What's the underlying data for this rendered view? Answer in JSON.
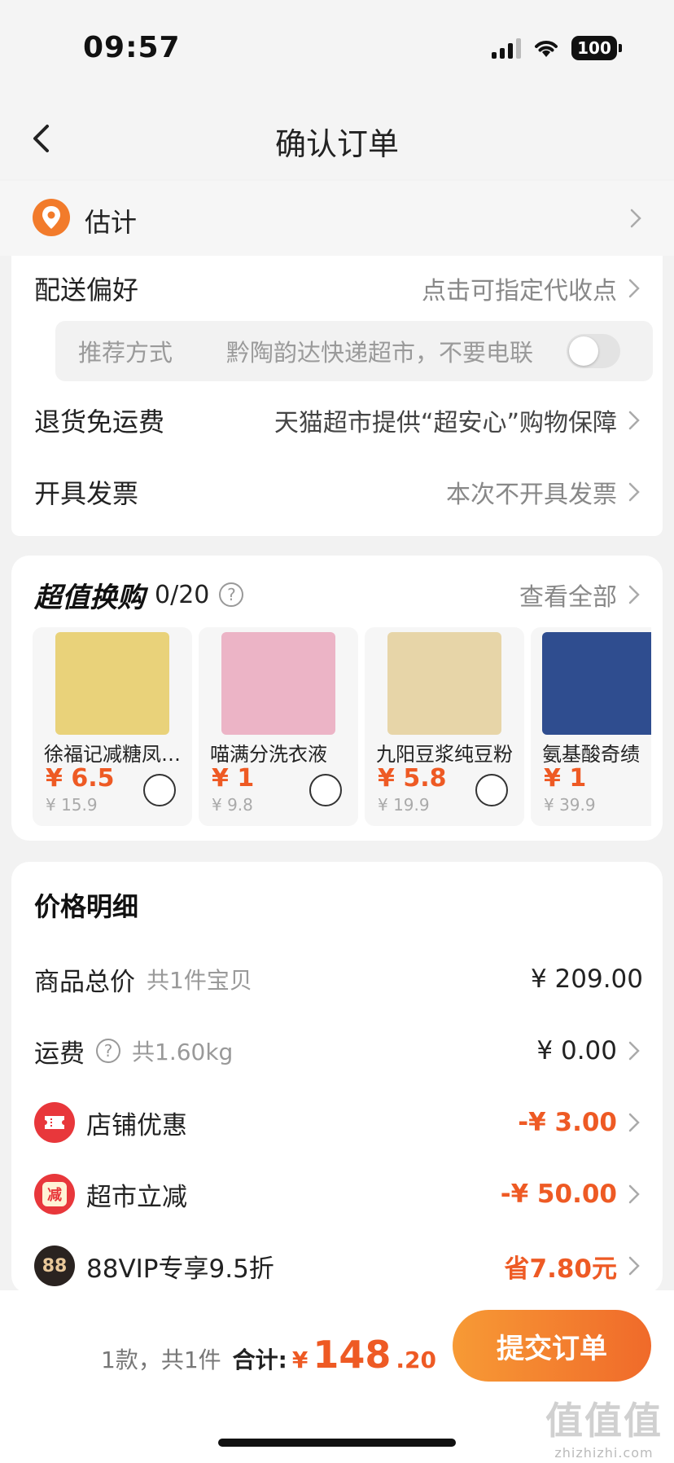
{
  "status_bar": {
    "time": "09:57",
    "battery": "100"
  },
  "nav": {
    "title": "确认订单"
  },
  "address": {
    "text": "估计"
  },
  "delivery": {
    "label": "配送偏好",
    "value": "点击可指定代收点",
    "pref_label": "推荐方式",
    "pref_value": "黔陶韵达快递超市，不要电联"
  },
  "return_shipping": {
    "label": "退货免运费",
    "value": "天猫超市提供“超安心”购物保障"
  },
  "invoice": {
    "label": "开具发票",
    "value": "本次不开具发票"
  },
  "swap": {
    "title": "超值换购",
    "count": "0/20",
    "view_all": "查看全部",
    "products": [
      {
        "name": "徐福记减糖凤梨酥",
        "price": "¥ 6.5",
        "original": "¥ 15.9",
        "img_color": "#e9d27a"
      },
      {
        "name": "喵满分洗衣液",
        "price": "¥ 1",
        "original": "¥ 9.8",
        "img_color": "#ecb4c6"
      },
      {
        "name": "九阳豆浆纯豆粉",
        "price": "¥ 5.8",
        "original": "¥ 19.9",
        "img_color": "#e7d5a8"
      },
      {
        "name": "氨基酸奇绩",
        "price": "¥ 1",
        "original": "¥ 39.9",
        "img_color": "#2f4d8f"
      }
    ]
  },
  "price_detail": {
    "title": "价格明细",
    "goods_total": {
      "label": "商品总价",
      "sub": "共1件宝贝",
      "value": "¥ 209.00"
    },
    "shipping": {
      "label": "运费",
      "sub": "共1.60kg",
      "value": "¥ 0.00"
    },
    "shop_discount": {
      "label": "店铺优惠",
      "value": "-¥ 3.00"
    },
    "market_discount": {
      "label": "超市立减",
      "value": "-¥ 50.00",
      "icon_char": "减"
    },
    "vip": {
      "label": "88VIP专享9.5折",
      "value": "省7.80元",
      "icon_char": "88"
    }
  },
  "bottom": {
    "count": "1款，共1件",
    "total_label": "合计:",
    "yen": "¥",
    "total_int": "148",
    "total_dec": ".20",
    "submit": "提交订单"
  },
  "watermark": {
    "logo": "值值值",
    "url": "zhizhizhi.com"
  },
  "colors": {
    "accent": "#ee5a24",
    "button_start": "#f79a35",
    "button_end": "#f06a2a"
  }
}
